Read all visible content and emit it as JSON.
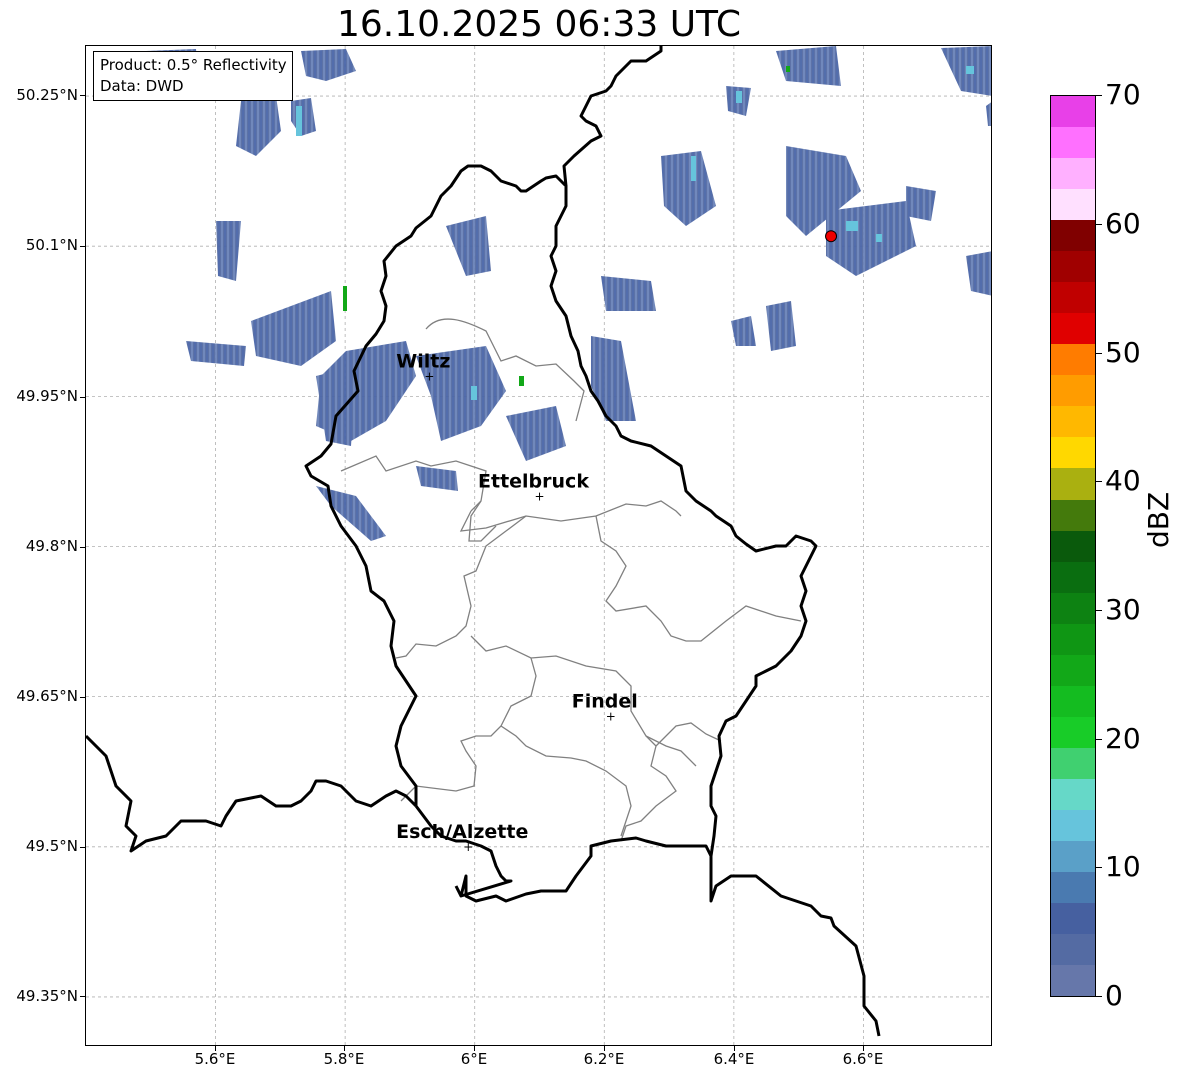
{
  "title": "16.10.2025 06:33 UTC",
  "info": {
    "product": "Product: 0.5° Reflectivity",
    "data": "Data: DWD"
  },
  "lat_labels": [
    "50.25°N",
    "50.1°N",
    "49.95°N",
    "49.8°N",
    "49.65°N",
    "49.5°N",
    "49.35°N"
  ],
  "lon_labels": [
    "5.6°E",
    "5.8°E",
    "6°E",
    "6.2°E",
    "6.4°E",
    "6.6°E"
  ],
  "colorbar": {
    "label": "dBZ",
    "ticks": [
      "0",
      "10",
      "20",
      "30",
      "40",
      "50",
      "60",
      "70"
    ],
    "colors": [
      "#6677aa",
      "#546ba3",
      "#4660a0",
      "#4a7ab0",
      "#5aa0c8",
      "#66c4dc",
      "#66d8c8",
      "#40d070",
      "#18cc28",
      "#14bc20",
      "#12a818",
      "#0f9614",
      "#0d8212",
      "#0a6e10",
      "#0a5a0c",
      "#447a0c",
      "#aab010",
      "#ffd800",
      "#ffb800",
      "#ff9c00",
      "#ff7c00",
      "#e00000",
      "#c00000",
      "#a00000",
      "#800000",
      "#ffe0ff",
      "#ffb0ff",
      "#ff70ff",
      "#e840e8"
    ]
  },
  "cities": [
    {
      "name": "Wiltz",
      "lon": 5.93,
      "lat": 49.97
    },
    {
      "name": "Ettelbruck",
      "lon": 6.1,
      "lat": 49.85
    },
    {
      "name": "Findel",
      "lon": 6.21,
      "lat": 49.63
    },
    {
      "name": "Esch/Alzette",
      "lon": 5.99,
      "lat": 49.5
    }
  ],
  "radar_site": {
    "lon": 6.55,
    "lat": 50.11,
    "color": "#ee0000"
  }
}
